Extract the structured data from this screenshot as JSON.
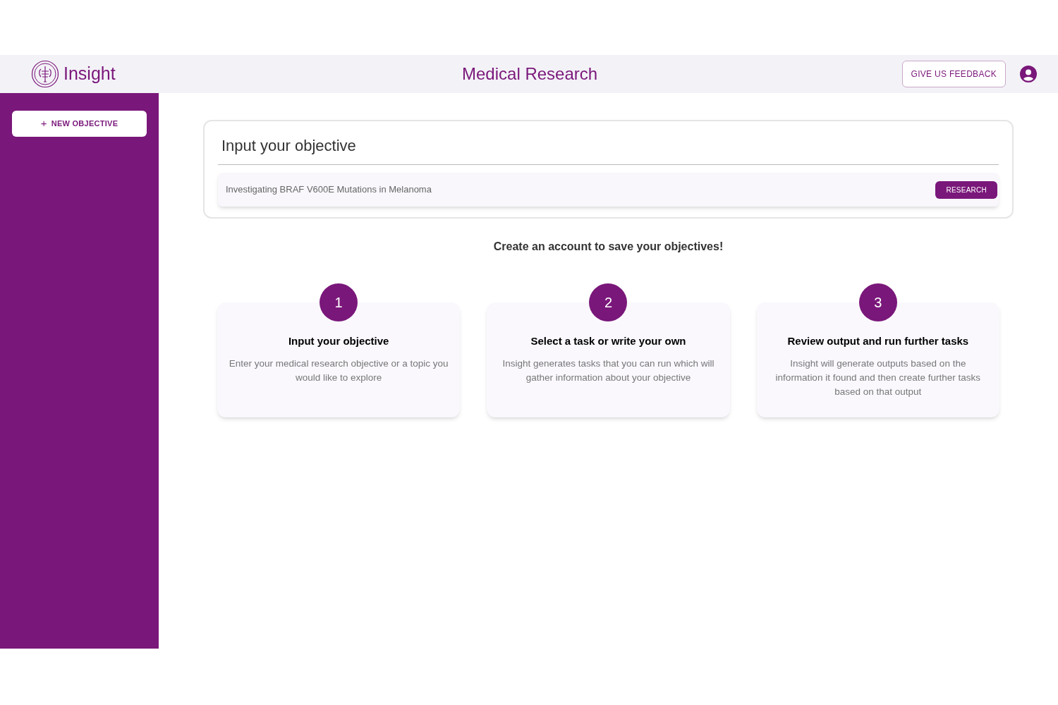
{
  "header": {
    "logo_text": "Insight",
    "title": "Medical Research",
    "feedback_button": "GIVE US FEEDBACK"
  },
  "sidebar": {
    "new_button_icon": "+",
    "new_button": "NEW OBJECTIVE"
  },
  "objective": {
    "heading": "Input your objective",
    "input": {
      "value": "Investigating BRAF V600E Mutations in Melanoma"
    },
    "button": "RESEARCH"
  },
  "notice": "Create an account to save your objectives!",
  "steps": [
    {
      "number": "1",
      "title": "Input your objective",
      "text": "Enter your medical research objective or a topic you would like to explore"
    },
    {
      "number": "2",
      "title": "Select a task or write your own",
      "text": "Insight generates tasks that you can run which will gather information about your objective"
    },
    {
      "number": "3",
      "title": "Review output and run further tasks",
      "text": "Insight will generate outputs based on the information it found and then create further tasks based on that output"
    }
  ]
}
